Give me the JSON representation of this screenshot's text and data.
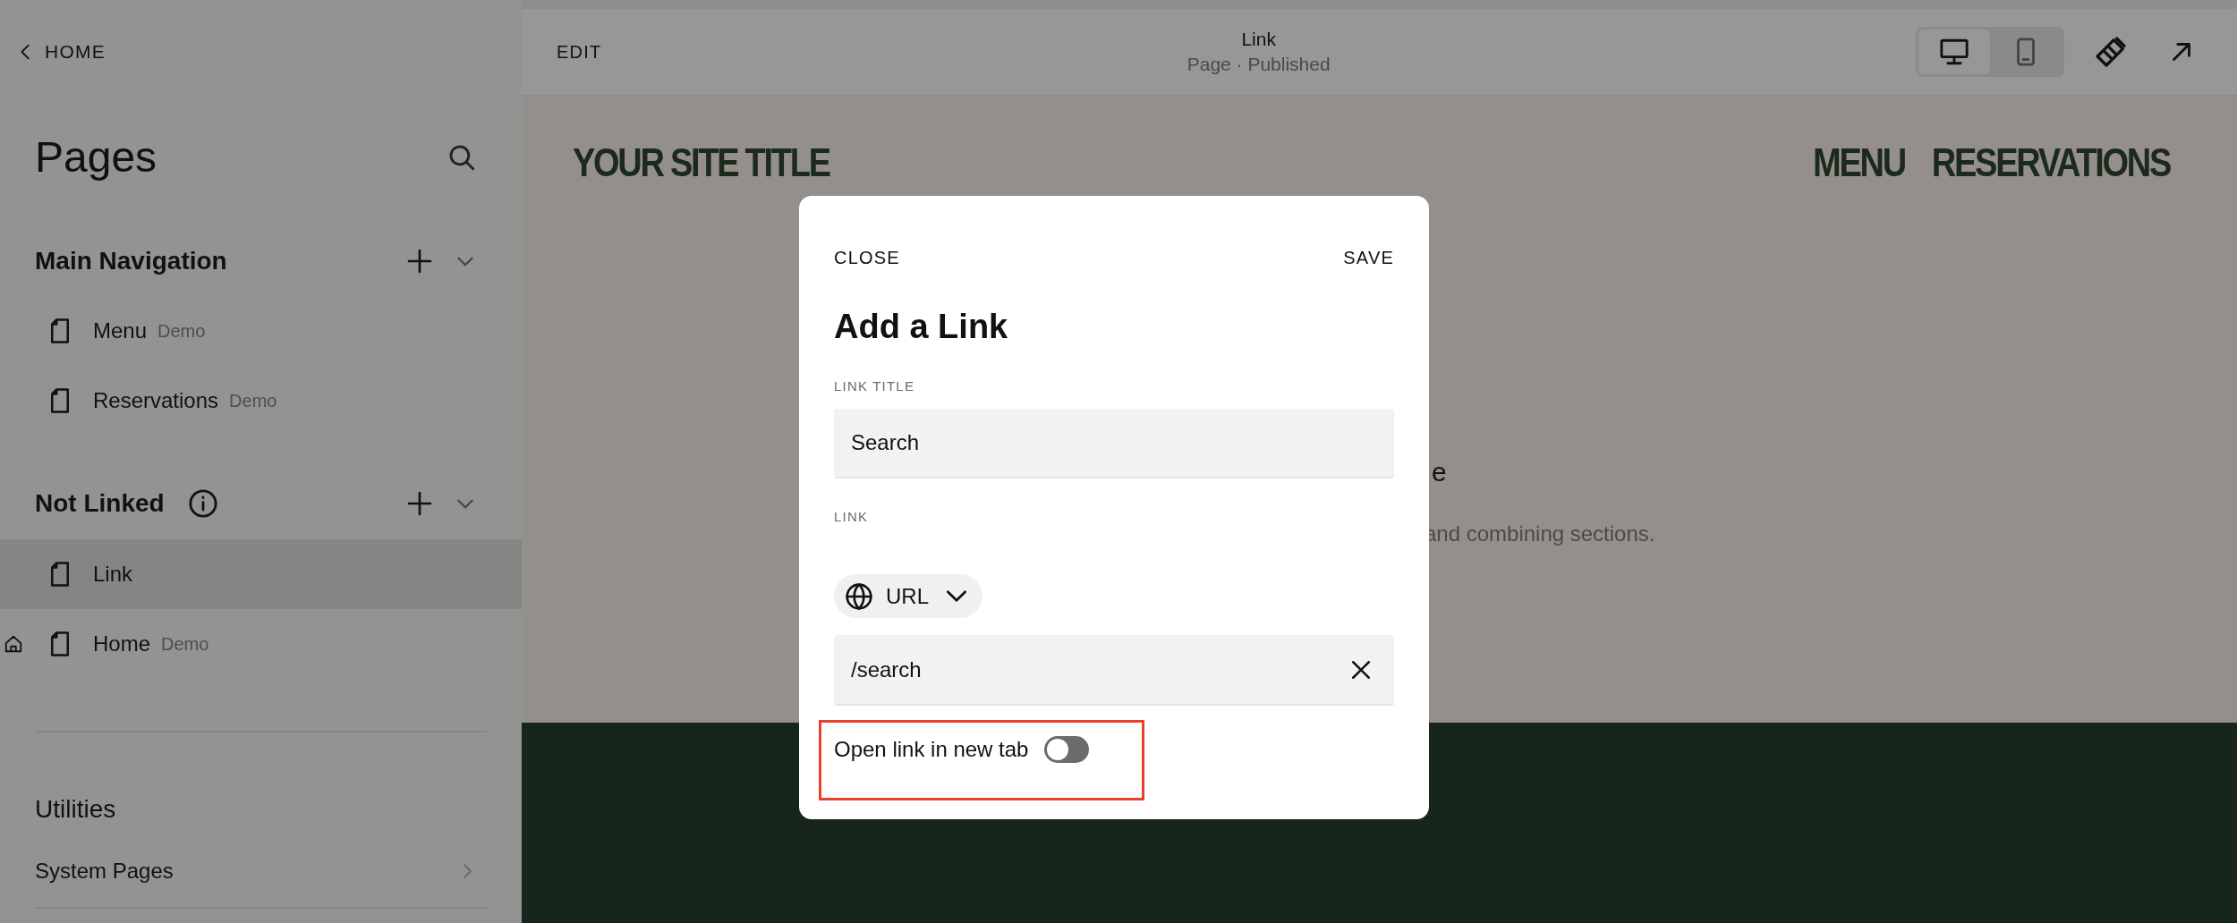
{
  "sidebar": {
    "back_link": "HOME",
    "title": "Pages",
    "sections": [
      {
        "title": "Main Navigation",
        "info_icon": false,
        "pages": [
          {
            "label": "Menu",
            "tag": "Demo",
            "selected": false,
            "home": false
          },
          {
            "label": "Reservations",
            "tag": "Demo",
            "selected": false,
            "home": false
          }
        ]
      },
      {
        "title": "Not Linked",
        "info_icon": true,
        "pages": [
          {
            "label": "Link",
            "selected": true,
            "home": false
          },
          {
            "label": "Home",
            "tag": "Demo",
            "selected": false,
            "home": true
          }
        ]
      }
    ],
    "utilities": {
      "title": "Utilities",
      "items": [
        "System Pages"
      ]
    }
  },
  "toolbar": {
    "edit": "EDIT",
    "title": "Link",
    "subtitle": "Page · Published",
    "devices": [
      {
        "kind": "desktop",
        "selected": true
      },
      {
        "kind": "mobile",
        "selected": false
      }
    ]
  },
  "site": {
    "title": "YOUR SITE TITLE",
    "nav": [
      "MENU",
      "RESERVATIONS"
    ],
    "heading_fragment": "e",
    "text_fragment": "and combining sections."
  },
  "dialog": {
    "close": "CLOSE",
    "save": "SAVE",
    "title": "Add a Link",
    "title_label": "LINK TITLE",
    "title_value": "Search",
    "link_label": "LINK",
    "link_type": "URL",
    "link_value": "/search",
    "new_tab_label": "Open link in new tab",
    "open_in_new_tab": false,
    "highlight": true
  }
}
